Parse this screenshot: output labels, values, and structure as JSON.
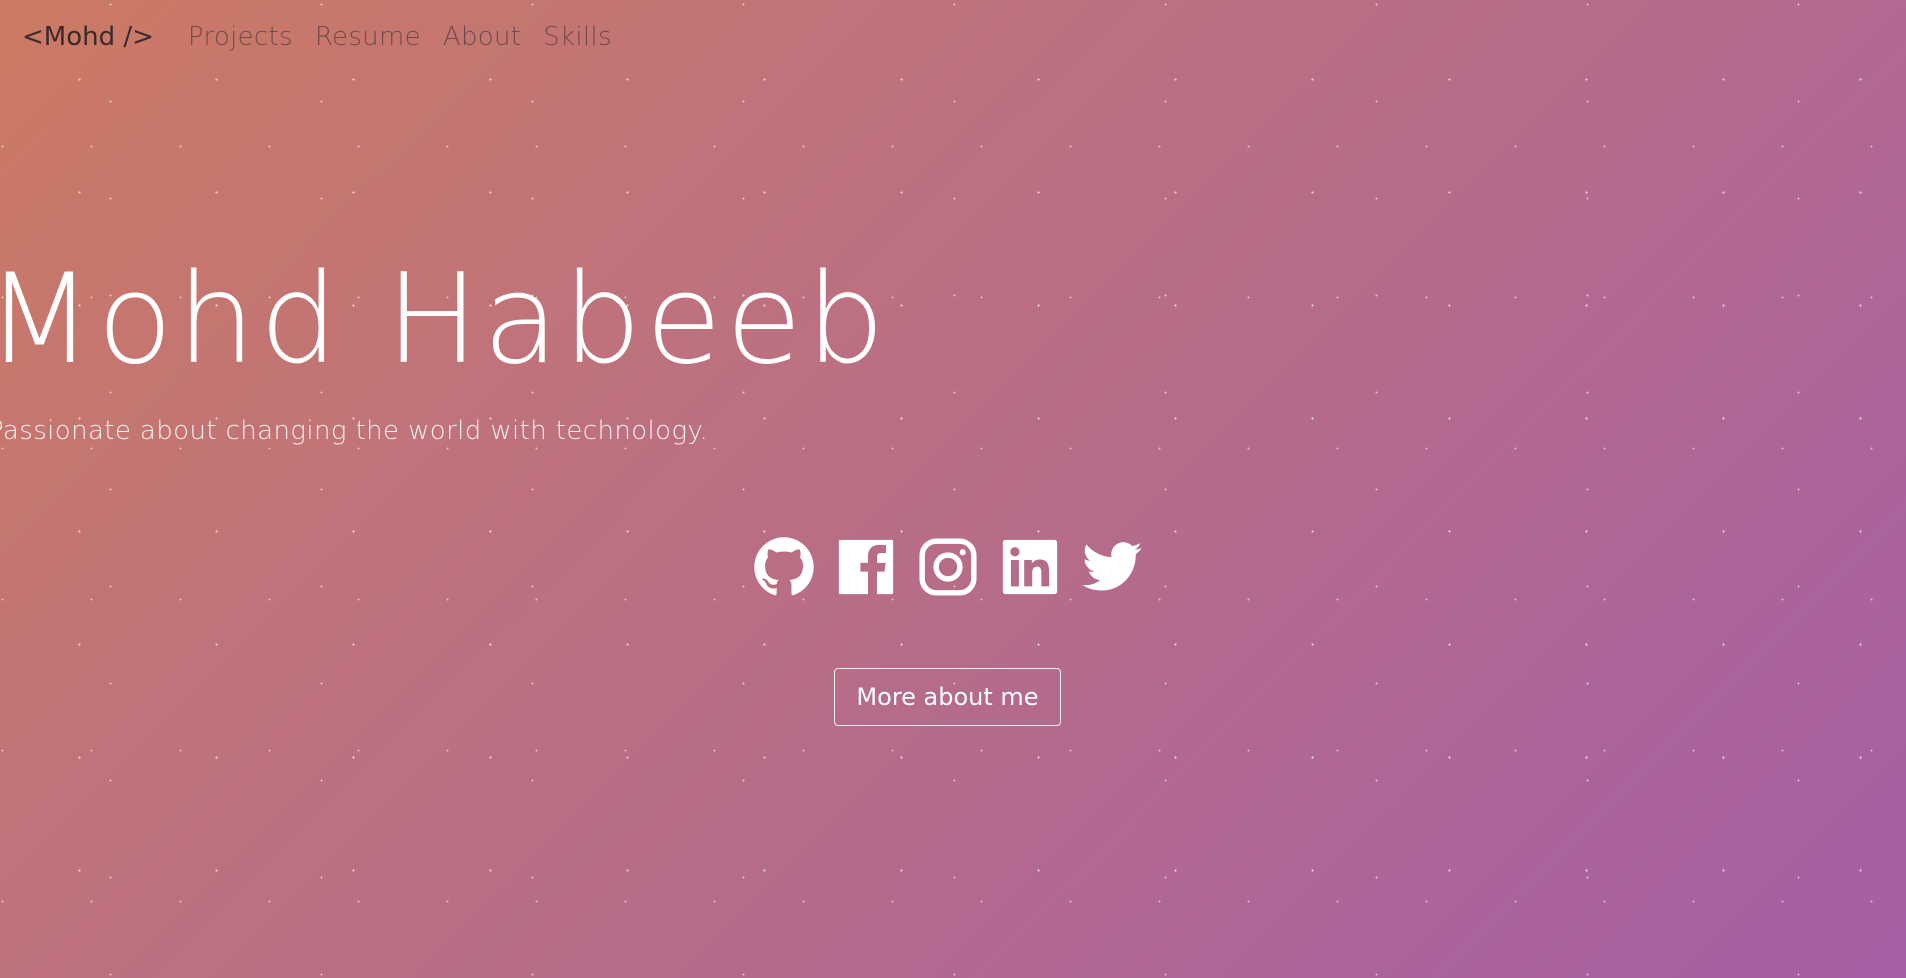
{
  "nav": {
    "brand": "<Mohd />",
    "links": [
      "Projects",
      "Resume",
      "About",
      "Skills"
    ]
  },
  "hero": {
    "name": "Mohd Habeeb",
    "tagline": "Passionate about changing the world with technology.",
    "button_label": "More about me",
    "socials": [
      "github-icon",
      "facebook-icon",
      "instagram-icon",
      "linkedin-icon",
      "twitter-icon"
    ]
  },
  "colors": {
    "gradient_start": "#cc7a62",
    "gradient_end": "#a45fa6",
    "text": "#ffffff"
  }
}
